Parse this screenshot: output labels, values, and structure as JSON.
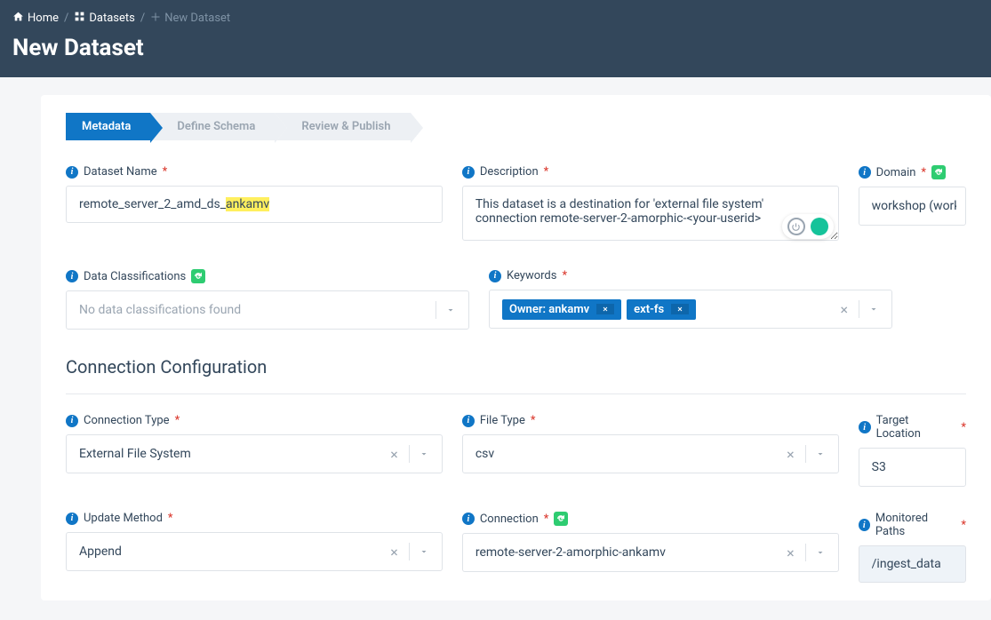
{
  "breadcrumb": {
    "home": "Home",
    "datasets": "Datasets",
    "current": "New Dataset"
  },
  "page_title": "New Dataset",
  "steps": [
    "Metadata",
    "Define Schema",
    "Review & Publish"
  ],
  "labels": {
    "dataset_name": "Dataset Name",
    "description": "Description",
    "domain": "Domain",
    "data_classifications": "Data Classifications",
    "keywords": "Keywords",
    "connection_configuration": "Connection Configuration",
    "connection_type": "Connection Type",
    "file_type": "File Type",
    "target_location": "Target Location",
    "update_method": "Update Method",
    "connection": "Connection",
    "monitored_paths": "Monitored Paths"
  },
  "values": {
    "dataset_name_prefix": "remote_server_2_amd_ds_",
    "dataset_name_highlight": "ankamv",
    "description": "This dataset is a destination for 'external file system' connection remote-server-2-amorphic-<your-userid>",
    "domain": "workshop (workshop)",
    "data_classifications_placeholder": "No data classifications found",
    "connection_type": "External File System",
    "file_type": "csv",
    "target_location": "S3",
    "update_method": "Append",
    "connection": "remote-server-2-amorphic-ankamv",
    "monitored_paths": "/ingest_data"
  },
  "keywords": [
    {
      "label": "Owner: ankamv"
    },
    {
      "label": "ext-fs"
    }
  ]
}
